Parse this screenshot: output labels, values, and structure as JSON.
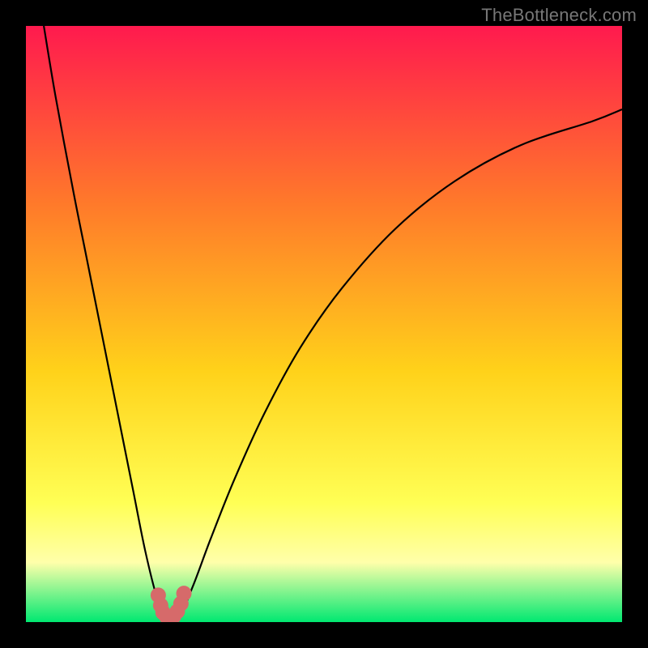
{
  "watermark": "TheBottleneck.com",
  "colors": {
    "frame": "#000000",
    "curve": "#000000",
    "marker": "#d66a6a",
    "gradient_top": "#ff1a4e",
    "gradient_mid_upper": "#ff7a2a",
    "gradient_mid": "#ffd21a",
    "gradient_mid_lower": "#ffff55",
    "gradient_band": "#ffffaa",
    "gradient_bottom": "#00e871"
  },
  "chart_data": {
    "type": "line",
    "title": "",
    "xlabel": "",
    "ylabel": "",
    "xlim": [
      0,
      100
    ],
    "ylim": [
      0,
      100
    ],
    "grid": false,
    "legend": false,
    "series": [
      {
        "name": "curve",
        "x": [
          3,
          5,
          8,
          10,
          12,
          14,
          16,
          18,
          20,
          22,
          23.5,
          25.5,
          28,
          31,
          35,
          40,
          46,
          53,
          62,
          72,
          83,
          95,
          100
        ],
        "y": [
          100,
          88,
          72,
          62,
          52,
          42,
          32,
          22,
          12,
          4,
          0.5,
          0.5,
          6,
          14,
          24,
          35,
          46,
          56,
          66,
          74,
          80,
          84,
          86
        ]
      }
    ],
    "markers": {
      "name": "u-shape-markers",
      "x": [
        22.2,
        22.6,
        23.0,
        23.6,
        24.2,
        24.8,
        25.4,
        26.0,
        26.5
      ],
      "y": [
        4.5,
        2.8,
        1.6,
        0.9,
        0.8,
        1.0,
        1.8,
        3.1,
        4.8
      ]
    }
  }
}
